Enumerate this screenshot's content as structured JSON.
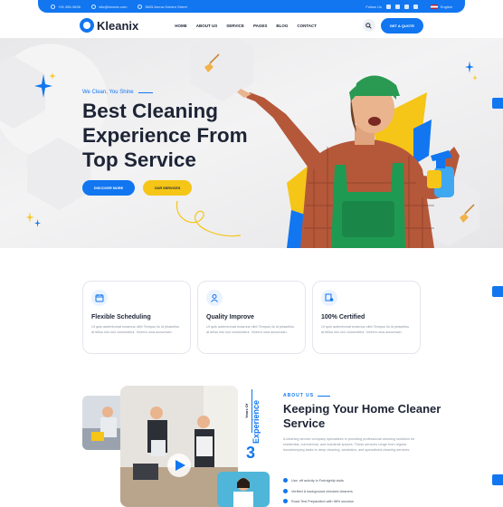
{
  "topbar": {
    "phone": "+00 456-3698",
    "email": "info@kleanix.com",
    "address": "5605 Arena Golden Street",
    "follow_label": "Follow Us",
    "language": "English"
  },
  "header": {
    "brand": "Kleanix",
    "nav": [
      "HOME",
      "ABOUT US",
      "SERVICE",
      "PAGES",
      "BLOG",
      "CONTACT"
    ],
    "quote_button": "GET A QUOTE"
  },
  "hero": {
    "tagline": "We Clean, You Shine",
    "title_line1": "Best Cleaning",
    "title_line2": "Experience From",
    "title_line3": "Top Service",
    "discover_button": "DISCOVER MORE",
    "services_button": "OUR SERVICES"
  },
  "features": [
    {
      "title": "Flexible Scheduling",
      "text": "Ut quis autemtomat erasmus nibh Tempus lio id phasellus at tellus nisi orci consectetur. Viverra urna accumsan.",
      "icon": "calendar-icon"
    },
    {
      "title": "Quality Improve",
      "text": "Ut quis autemtomat erasmus nibh Tempus lio id phasellus at tellus nisi orci consectetur. Viverra urna accumsan.",
      "icon": "worker-icon"
    },
    {
      "title": "100% Certified",
      "text": "Ut quis autemtomat erasmus nibh Tempus lio id phasellus at tellus nisi orci consectetur. Viverra urna accumsan.",
      "icon": "certificate-icon"
    }
  ],
  "about": {
    "label": "ABOUT US",
    "title": "Keeping Your Home Cleaner Service",
    "text": "A cleaning service company specializes in providing professional cleaning solutions for residential, commercial, and industrial spaces. These services range from regular housekeeping tasks to deep cleaning, sanitation, and specialized cleaning services.",
    "checks": [
      "Use, eff activity in Fortnightly visits",
      "Verified & background checked cleaners",
      "Road Test Preparation with 98% success"
    ],
    "years_label": "Years Of",
    "experience_label": "Experience",
    "years_value": "3"
  },
  "colors": {
    "accent": "#1176f0",
    "yellow": "#f5c518",
    "dark": "#1d2435"
  }
}
